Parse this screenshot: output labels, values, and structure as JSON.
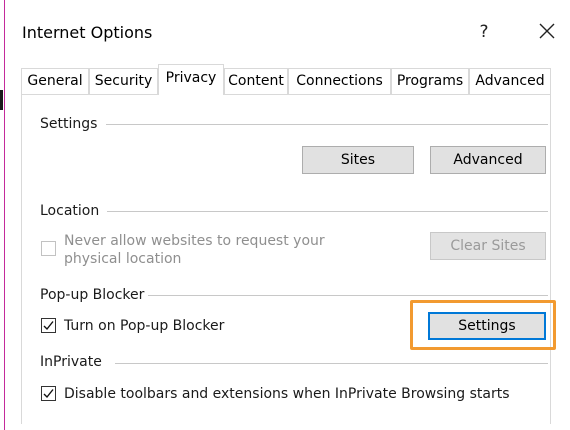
{
  "window": {
    "title": "Internet Options",
    "help_label": "?",
    "close_label": "✕"
  },
  "tabs": [
    {
      "label": "General"
    },
    {
      "label": "Security"
    },
    {
      "label": "Privacy",
      "active": true
    },
    {
      "label": "Content"
    },
    {
      "label": "Connections"
    },
    {
      "label": "Programs"
    },
    {
      "label": "Advanced"
    }
  ],
  "settings": {
    "heading": "Settings",
    "sites_button": "Sites",
    "advanced_button": "Advanced"
  },
  "location": {
    "heading": "Location",
    "checkbox_label_line1": "Never allow websites to request your",
    "checkbox_label_line2": "physical location",
    "checkbox_checked": false,
    "checkbox_enabled": false,
    "clear_sites_button": "Clear Sites"
  },
  "popup": {
    "heading": "Pop-up Blocker",
    "checkbox_label": "Turn on Pop-up Blocker",
    "checkbox_checked": true,
    "settings_button": "Settings",
    "highlight_color": "#f29a30"
  },
  "inprivate": {
    "heading": "InPrivate",
    "checkbox_label": "Disable toolbars and extensions when InPrivate Browsing starts",
    "checkbox_checked": true
  }
}
